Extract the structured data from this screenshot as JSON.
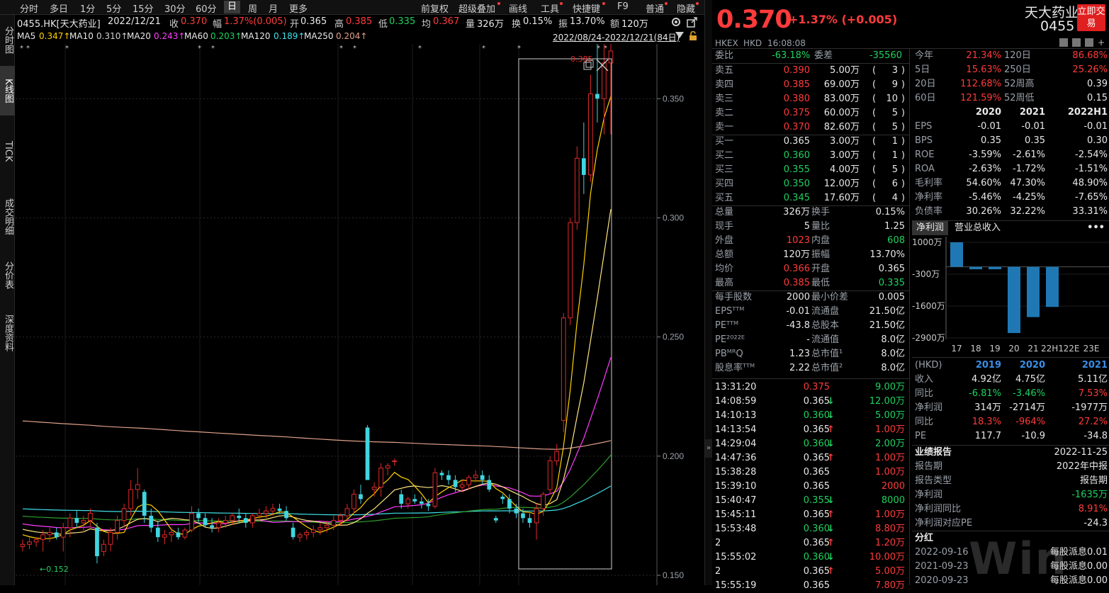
{
  "colors": {
    "up": "#ff3b3b",
    "down": "#1fd15f",
    "ma5": "#ffd200",
    "ma10": "#ffe680",
    "ma20": "#ff3cff",
    "ma60": "#2ca02c",
    "ma120": "#3fe0e8",
    "ma250": "#e0a08a",
    "box": "#d0d0d0",
    "bg": "#000000"
  },
  "toolbar": {
    "items": [
      {
        "label": "分时"
      },
      {
        "label": "多日"
      },
      {
        "label": "1分"
      },
      {
        "label": "5分"
      },
      {
        "label": "15分"
      },
      {
        "label": "30分"
      },
      {
        "label": "60分"
      },
      {
        "label": "日",
        "selected": true
      },
      {
        "label": "周"
      },
      {
        "label": "月"
      },
      {
        "label": "更多"
      }
    ],
    "right_items": [
      {
        "label": "前复权"
      },
      {
        "label": "超级叠加"
      },
      {
        "label": "画线"
      },
      {
        "label": "工具"
      },
      {
        "label": "快捷键"
      },
      {
        "label": "F9"
      },
      {
        "label": "普通"
      },
      {
        "label": "隐藏"
      }
    ]
  },
  "sidebar": {
    "items": [
      {
        "label": "分时图"
      },
      {
        "label": "K线图",
        "selected": true
      },
      {
        "label": "TICK"
      },
      {
        "label": "成交明细"
      },
      {
        "label": "分价表"
      },
      {
        "label": "深度资料"
      }
    ]
  },
  "quote_line": {
    "code": "0455.HK[天大药业]",
    "date": "2022/12/21",
    "close_label": "收",
    "close": "0.370",
    "amp_label": "幅",
    "amp": "1.37%(0.005)",
    "open_label": "开",
    "open": "0.365",
    "high_label": "高",
    "high": "0.385",
    "low_label": "低",
    "low": "0.335",
    "avg_label": "均",
    "avg": "0.367",
    "vol_label": "量",
    "vol": "326万",
    "turn_label": "换",
    "turn": "0.15%",
    "swing_label": "振",
    "swing": "13.70%",
    "amt_label": "额",
    "amt": "120万"
  },
  "ma_line": {
    "items": [
      {
        "label": "MA5",
        "value": "0.347↑"
      },
      {
        "label": "MA10",
        "value": "0.310↑"
      },
      {
        "label": "MA20",
        "value": "0.243↑"
      },
      {
        "label": "MA60",
        "value": "0.203↑"
      },
      {
        "label": "MA120",
        "value": "0.189↑"
      },
      {
        "label": "MA250",
        "value": "0.204↑"
      }
    ],
    "range": "2022/08/24-2022/12/21(84日)"
  },
  "chart_data": {
    "type": "candlestick",
    "y_ticks": [
      "0.350",
      "0.300",
      "0.250",
      "0.200",
      "0.150"
    ],
    "ylim": [
      0.15,
      0.37
    ],
    "annotations": {
      "high_label": "0.385",
      "low_label": "←0.152"
    },
    "candles": [
      [
        0.162,
        0.165,
        0.16,
        0.163
      ],
      [
        0.163,
        0.166,
        0.161,
        0.164
      ],
      [
        0.164,
        0.166,
        0.162,
        0.165
      ],
      [
        0.165,
        0.169,
        0.16,
        0.167
      ],
      [
        0.167,
        0.17,
        0.164,
        0.168
      ],
      [
        0.168,
        0.17,
        0.165,
        0.166
      ],
      [
        0.166,
        0.172,
        0.16,
        0.17
      ],
      [
        0.17,
        0.176,
        0.166,
        0.174
      ],
      [
        0.174,
        0.177,
        0.17,
        0.172
      ],
      [
        0.172,
        0.175,
        0.168,
        0.173
      ],
      [
        0.173,
        0.178,
        0.17,
        0.176
      ],
      [
        0.17,
        0.172,
        0.155,
        0.158
      ],
      [
        0.16,
        0.165,
        0.158,
        0.163
      ],
      [
        0.163,
        0.17,
        0.16,
        0.168
      ],
      [
        0.168,
        0.175,
        0.165,
        0.173
      ],
      [
        0.173,
        0.18,
        0.17,
        0.178
      ],
      [
        0.178,
        0.19,
        0.175,
        0.186
      ],
      [
        0.186,
        0.195,
        0.182,
        0.188
      ],
      [
        0.185,
        0.186,
        0.172,
        0.175
      ],
      [
        0.175,
        0.178,
        0.168,
        0.17
      ],
      [
        0.17,
        0.173,
        0.164,
        0.166
      ],
      [
        0.166,
        0.169,
        0.163,
        0.167
      ],
      [
        0.167,
        0.17,
        0.164,
        0.168
      ],
      [
        0.168,
        0.17,
        0.165,
        0.166
      ],
      [
        0.166,
        0.17,
        0.165,
        0.169
      ],
      [
        0.169,
        0.179,
        0.168,
        0.176
      ],
      [
        0.176,
        0.178,
        0.172,
        0.174
      ],
      [
        0.174,
        0.176,
        0.17,
        0.171
      ],
      [
        0.171,
        0.174,
        0.168,
        0.17
      ],
      [
        0.17,
        0.174,
        0.168,
        0.172
      ],
      [
        0.172,
        0.175,
        0.17,
        0.173
      ],
      [
        0.173,
        0.176,
        0.171,
        0.175
      ],
      [
        0.175,
        0.178,
        0.172,
        0.174
      ],
      [
        0.174,
        0.176,
        0.17,
        0.172
      ],
      [
        0.172,
        0.176,
        0.17,
        0.175
      ],
      [
        0.175,
        0.178,
        0.173,
        0.176
      ],
      [
        0.176,
        0.179,
        0.174,
        0.177
      ],
      [
        0.177,
        0.18,
        0.175,
        0.178
      ],
      [
        0.178,
        0.18,
        0.176,
        0.177
      ],
      [
        0.177,
        0.179,
        0.173,
        0.174
      ],
      [
        0.17,
        0.172,
        0.165,
        0.166
      ],
      [
        0.166,
        0.168,
        0.164,
        0.167
      ],
      [
        0.167,
        0.169,
        0.165,
        0.168
      ],
      [
        0.168,
        0.171,
        0.166,
        0.169
      ],
      [
        0.169,
        0.172,
        0.167,
        0.17
      ],
      [
        0.17,
        0.173,
        0.168,
        0.171
      ],
      [
        0.171,
        0.175,
        0.169,
        0.173
      ],
      [
        0.173,
        0.176,
        0.171,
        0.175
      ],
      [
        0.175,
        0.18,
        0.173,
        0.178
      ],
      [
        0.178,
        0.186,
        0.176,
        0.184
      ],
      [
        0.184,
        0.188,
        0.18,
        0.182
      ],
      [
        0.212,
        0.213,
        0.19,
        0.19
      ],
      [
        0.186,
        0.189,
        0.183,
        0.187
      ],
      [
        0.187,
        0.197,
        0.183,
        0.195
      ],
      [
        0.195,
        0.197,
        0.192,
        0.196
      ],
      [
        0.198,
        0.199,
        0.196,
        0.198
      ],
      [
        0.184,
        0.186,
        0.178,
        0.18
      ],
      [
        0.18,
        0.183,
        0.178,
        0.182
      ],
      [
        0.182,
        0.184,
        0.18,
        0.181
      ],
      [
        0.181,
        0.183,
        0.178,
        0.18
      ],
      [
        0.18,
        0.182,
        0.177,
        0.179
      ],
      [
        0.179,
        0.195,
        0.178,
        0.193
      ],
      [
        0.193,
        0.194,
        0.19,
        0.192
      ],
      [
        0.192,
        0.194,
        0.188,
        0.19
      ],
      [
        0.19,
        0.192,
        0.185,
        0.187
      ],
      [
        0.187,
        0.19,
        0.185,
        0.188
      ],
      [
        0.188,
        0.192,
        0.186,
        0.191
      ],
      [
        0.191,
        0.194,
        0.189,
        0.192
      ],
      [
        0.192,
        0.194,
        0.188,
        0.19
      ],
      [
        0.19,
        0.192,
        0.185,
        0.186
      ],
      [
        0.174,
        0.175,
        0.172,
        0.173
      ],
      [
        0.183,
        0.184,
        0.18,
        0.182
      ],
      [
        0.182,
        0.184,
        0.176,
        0.178
      ],
      [
        0.178,
        0.18,
        0.174,
        0.176
      ],
      [
        0.176,
        0.178,
        0.172,
        0.174
      ],
      [
        0.174,
        0.176,
        0.17,
        0.172
      ],
      [
        0.172,
        0.18,
        0.165,
        0.178
      ],
      [
        0.178,
        0.185,
        0.175,
        0.184
      ],
      [
        0.186,
        0.2,
        0.184,
        0.198
      ],
      [
        0.198,
        0.205,
        0.196,
        0.202
      ],
      [
        0.215,
        0.26,
        0.21,
        0.258
      ],
      [
        0.258,
        0.3,
        0.255,
        0.298
      ],
      [
        0.298,
        0.33,
        0.295,
        0.325
      ],
      [
        0.325,
        0.34,
        0.31,
        0.318
      ],
      [
        0.318,
        0.36,
        0.315,
        0.352
      ],
      [
        0.352,
        0.375,
        0.34,
        0.35
      ],
      [
        0.35,
        0.385,
        0.335,
        0.365
      ],
      [
        0.365,
        0.385,
        0.335,
        0.37
      ]
    ]
  },
  "header": {
    "price": "0.370",
    "change": "+1.37% (+0.005)",
    "name": "天大药业",
    "code": "0455",
    "trade_btn": "立即交易",
    "market": "HKEX",
    "currency": "HKD",
    "time": "16:08:08"
  },
  "order": {
    "wb_label": "委比",
    "wb": "-63.18%",
    "wc_label": "委差",
    "wc": "-35560",
    "asks": [
      {
        "label": "卖五",
        "price": "0.390",
        "vol": "5.00万",
        "n": "3"
      },
      {
        "label": "卖四",
        "price": "0.385",
        "vol": "69.00万",
        "n": "9"
      },
      {
        "label": "卖三",
        "price": "0.380",
        "vol": "83.00万",
        "n": "10"
      },
      {
        "label": "卖二",
        "price": "0.375",
        "vol": "60.00万",
        "n": "5"
      },
      {
        "label": "卖一",
        "price": "0.370",
        "vol": "82.60万",
        "n": "5"
      }
    ],
    "bids": [
      {
        "label": "买一",
        "price": "0.365",
        "vol": "3.00万",
        "n": "1"
      },
      {
        "label": "买二",
        "price": "0.360",
        "vol": "3.00万",
        "n": "1"
      },
      {
        "label": "买三",
        "price": "0.355",
        "vol": "4.00万",
        "n": "5"
      },
      {
        "label": "买四",
        "price": "0.350",
        "vol": "12.00万",
        "n": "6"
      },
      {
        "label": "买五",
        "price": "0.345",
        "vol": "17.60万",
        "n": "4"
      }
    ]
  },
  "stats": [
    {
      "l1": "总量",
      "v1": "326万",
      "c1": "wht",
      "l2": "换手",
      "v2": "0.15%",
      "c2": "wht"
    },
    {
      "l1": "现手",
      "v1": "5",
      "c1": "wht",
      "l2": "量比",
      "v2": "1.25",
      "c2": "wht"
    },
    {
      "l1": "外盘",
      "v1": "1023",
      "c1": "red",
      "l2": "内盘",
      "v2": "608",
      "c2": "grn"
    },
    {
      "l1": "总额",
      "v1": "120万",
      "c1": "wht",
      "l2": "振幅",
      "v2": "13.70%",
      "c2": "wht"
    },
    {
      "l1": "均价",
      "v1": "0.366",
      "c1": "red",
      "l2": "开盘",
      "v2": "0.365",
      "c2": "wht"
    },
    {
      "l1": "最高",
      "v1": "0.385",
      "c1": "red",
      "l2": "最低",
      "v2": "0.335",
      "c2": "grn"
    },
    {
      "l1": "每手股数",
      "v1": "2000",
      "c1": "wht",
      "l2": "最小价差",
      "v2": "0.005",
      "c2": "wht"
    },
    {
      "l1": "EPSᵀᵀᴹ",
      "v1": "-0.01",
      "c1": "wht",
      "l2": "流通盘",
      "v2": "21.50亿",
      "c2": "wht"
    },
    {
      "l1": "PEᵀᵀᴹ",
      "v1": "-43.8",
      "c1": "wht",
      "l2": "总股本",
      "v2": "21.50亿",
      "c2": "wht"
    },
    {
      "l1": "PE²⁰²²ᴱ",
      "v1": "-",
      "c1": "wht",
      "l2": "流通值",
      "v2": "8.0亿",
      "c2": "wht"
    },
    {
      "l1": "PBᴹᴿQ",
      "v1": "1.23",
      "c1": "wht",
      "l2": "总市值¹",
      "v2": "8.0亿",
      "c2": "wht"
    },
    {
      "l1": "股息率ᵀᵀᴹ",
      "v1": "2.22",
      "c1": "wht",
      "l2": "总市值²",
      "v2": "8.0亿",
      "c2": "wht"
    }
  ],
  "ticks": [
    {
      "time": "13:31:20",
      "price": "0.375",
      "pc": "red",
      "arrow": "",
      "vol": "9.00万",
      "vc": "grn"
    },
    {
      "time": "14:08:59",
      "price": "0.365",
      "pc": "wht",
      "arrow": "↓",
      "ac": "grn",
      "vol": "12.00万",
      "vc": "grn"
    },
    {
      "time": "14:10:13",
      "price": "0.360",
      "pc": "grn",
      "arrow": "↓",
      "ac": "grn",
      "vol": "5.00万",
      "vc": "grn"
    },
    {
      "time": "14:13:54",
      "price": "0.365",
      "pc": "wht",
      "arrow": "↑",
      "ac": "red",
      "vol": "1.00万",
      "vc": "red"
    },
    {
      "time": "14:29:04",
      "price": "0.360",
      "pc": "grn",
      "arrow": "↓",
      "ac": "grn",
      "vol": "2.00万",
      "vc": "grn"
    },
    {
      "time": "14:47:36",
      "price": "0.365",
      "pc": "wht",
      "arrow": "↑",
      "ac": "red",
      "vol": "1.00万",
      "vc": "red"
    },
    {
      "time": "15:38:28",
      "price": "0.365",
      "pc": "wht",
      "arrow": "",
      "vol": "1.00万",
      "vc": "red"
    },
    {
      "time": "15:39:10",
      "price": "0.365",
      "pc": "wht",
      "arrow": "",
      "vol": "2000",
      "vc": "red"
    },
    {
      "time": "15:40:47",
      "price": "0.355",
      "pc": "grn",
      "arrow": "↓",
      "ac": "grn",
      "vol": "8000",
      "vc": "grn"
    },
    {
      "time": "15:45:11",
      "price": "0.365",
      "pc": "wht",
      "arrow": "↑",
      "ac": "red",
      "vol": "1.00万",
      "vc": "red"
    },
    {
      "time": "15:53:48",
      "price": "0.360",
      "pc": "grn",
      "arrow": "↓",
      "ac": "grn",
      "vol": "8.80万",
      "vc": "red"
    },
    {
      "time": "2",
      "price": "0.365",
      "pc": "wht",
      "arrow": "↑",
      "ac": "red",
      "vol": "1.20万",
      "vc": "red"
    },
    {
      "time": "15:55:02",
      "price": "0.360",
      "pc": "grn",
      "arrow": "↓",
      "ac": "grn",
      "vol": "10.00万",
      "vc": "red"
    },
    {
      "time": "2",
      "price": "0.365",
      "pc": "wht",
      "arrow": "↑",
      "ac": "red",
      "vol": "5.00万",
      "vc": "red"
    },
    {
      "time": "15:55:19",
      "price": "0.365",
      "pc": "wht",
      "arrow": "",
      "vol": "7.80万",
      "vc": "red"
    }
  ],
  "fin": {
    "periods": [
      {
        "l1": "今年",
        "v1": "21.34%",
        "l2": "120日",
        "v2": "86.68%"
      },
      {
        "l1": "5日",
        "v1": "15.63%",
        "l2": "250日",
        "v2": "25.26%"
      },
      {
        "l1": "20日",
        "v1": "112.68%",
        "l2": "52周高",
        "v2": "0.39",
        "c2": "wht"
      },
      {
        "l1": "60日",
        "v1": "121.59%",
        "l2": "52周低",
        "v2": "0.15",
        "c2": "wht"
      }
    ],
    "years": [
      "2020",
      "2021",
      "2022H1"
    ],
    "rows": [
      {
        "l": "EPS",
        "v": [
          "-0.01",
          "-0.01",
          "-0.01"
        ]
      },
      {
        "l": "BPS",
        "v": [
          "0.35",
          "0.35",
          "0.30"
        ]
      },
      {
        "l": "ROE",
        "v": [
          "-3.59%",
          "-2.61%",
          "-2.54%"
        ]
      },
      {
        "l": "ROA",
        "v": [
          "-2.63%",
          "-1.72%",
          "-1.51%"
        ]
      },
      {
        "l": "毛利率",
        "v": [
          "54.60%",
          "47.30%",
          "48.90%"
        ]
      },
      {
        "l": "净利率",
        "v": [
          "-5.46%",
          "-4.25%",
          "-7.65%"
        ]
      },
      {
        "l": "负债率",
        "v": [
          "30.26%",
          "32.22%",
          "33.31%"
        ]
      }
    ]
  },
  "bar_tabs": {
    "t1": "净利润",
    "t2": "营业总收入",
    "more": "•••"
  },
  "bar_chart": {
    "y_ticks": [
      "1000万",
      "-300万",
      "-1600万",
      "-2900万"
    ],
    "x_ticks": [
      "17",
      "18",
      "19",
      "20",
      "21",
      "22H1",
      "22E",
      "23E"
    ],
    "values": [
      1000,
      -100,
      -100,
      -2700,
      -2050,
      -1635
    ]
  },
  "annual": {
    "unit": "(HKD)",
    "years": [
      "2019",
      "2020",
      "2021"
    ],
    "rows": [
      {
        "l": "收入",
        "v": [
          "4.92亿",
          "4.75亿",
          "5.11亿"
        ],
        "c": [
          "wht",
          "wht",
          "wht"
        ]
      },
      {
        "l": "同比",
        "v": [
          "-6.81%",
          "-3.46%",
          "7.53%"
        ],
        "c": [
          "grn",
          "grn",
          "red"
        ]
      },
      {
        "l": "净利润",
        "v": [
          "314万",
          "-2714万",
          "-1977万"
        ],
        "c": [
          "wht",
          "wht",
          "wht"
        ]
      },
      {
        "l": "同比",
        "v": [
          "18.3%",
          "-964%",
          "27.2%"
        ],
        "c": [
          "red",
          "red",
          "red"
        ]
      },
      {
        "l": "PE",
        "v": [
          "117.7",
          "-10.9",
          "-34.8"
        ],
        "c": [
          "wht",
          "wht",
          "wht"
        ]
      }
    ]
  },
  "report": {
    "title": "业绩报告",
    "date": "2022-11-25",
    "rows": [
      {
        "l": "报告期",
        "v": "2022年中报",
        "c": "wht"
      },
      {
        "l": "报告类型",
        "v": "报告期",
        "c": "wht"
      },
      {
        "l": "净利润",
        "v": "-1635万",
        "c": "grn"
      },
      {
        "l": "净利润同比",
        "v": "8.91%",
        "c": "red"
      },
      {
        "l": "净利润对应PE",
        "v": "-24.3",
        "c": "wht"
      }
    ]
  },
  "dividend": {
    "title": "分红",
    "rows": [
      {
        "d": "2022-09-16",
        "v": "每股派息0.01"
      },
      {
        "d": "2021-09-23",
        "v": "每股派息0.00"
      },
      {
        "d": "2020-09-23",
        "v": "每股派息0.00"
      }
    ]
  },
  "watermark": "Win"
}
